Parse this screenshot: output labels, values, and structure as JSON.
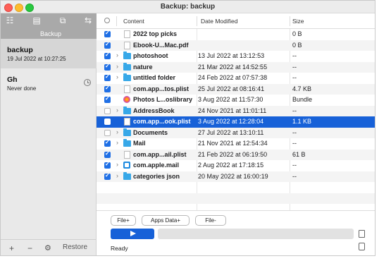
{
  "window": {
    "title": "Backup: backup"
  },
  "sidebar": {
    "section_label": "Backup",
    "items": [
      {
        "name": "backup",
        "subtitle": "19 Jul 2022 at 10:27:25",
        "selected": true
      },
      {
        "name": "Gh",
        "subtitle": "Never done",
        "selected": false
      }
    ],
    "bottom": {
      "add": "+",
      "remove": "−",
      "settings_icon": "gear-icon",
      "restore": "Restore"
    }
  },
  "table": {
    "headers": {
      "content": "Content",
      "date": "Date Modified",
      "size": "Size"
    },
    "rows": [
      {
        "checked": true,
        "expand": false,
        "icon": "file",
        "name": "2022 top picks",
        "date": "",
        "size": "0 B"
      },
      {
        "checked": true,
        "expand": false,
        "icon": "file",
        "name": "Ebook-U...Mac.pdf",
        "date": "",
        "size": "0 B"
      },
      {
        "checked": true,
        "expand": true,
        "icon": "folder",
        "name": "photoshoot",
        "date": "13 Jul 2022 at 13:12:53",
        "size": "--"
      },
      {
        "checked": true,
        "expand": true,
        "icon": "folder",
        "name": "nature",
        "date": "21 Mar 2022 at 14:52:55",
        "size": "--"
      },
      {
        "checked": true,
        "expand": true,
        "icon": "folder",
        "name": "untitled folder",
        "date": "24 Feb 2022 at 07:57:38",
        "size": "--"
      },
      {
        "checked": true,
        "expand": false,
        "icon": "file",
        "name": "com.app...tos.plist",
        "date": "25 Jul 2022 at 08:16:41",
        "size": "4.7 KB"
      },
      {
        "checked": true,
        "expand": false,
        "icon": "lib",
        "name": "Photos L...oslibrary",
        "date": "3 Aug 2022 at 11:57:30",
        "size": "Bundle"
      },
      {
        "checked": false,
        "expand": true,
        "icon": "folder",
        "name": "AddressBook",
        "date": "24 Nov 2021 at 11:01:11",
        "size": "--"
      },
      {
        "checked": false,
        "expand": false,
        "icon": "file",
        "name": "com.app...ook.plist",
        "date": "3 Aug 2022 at 12:28:04",
        "size": "1.1 KB",
        "selected": true
      },
      {
        "checked": false,
        "expand": true,
        "icon": "folder",
        "name": "Documents",
        "date": "27 Jul 2022 at 13:10:11",
        "size": "--"
      },
      {
        "checked": true,
        "expand": true,
        "icon": "folder",
        "name": "Mail",
        "date": "21 Nov 2021 at 12:54:34",
        "size": "--"
      },
      {
        "checked": true,
        "expand": false,
        "icon": "file",
        "name": "com.app...ail.plist",
        "date": "21 Feb 2022 at 06:19:50",
        "size": "61 B"
      },
      {
        "checked": true,
        "expand": true,
        "icon": "app",
        "name": "com.apple.mail",
        "date": "2 Aug 2022 at 17:18:15",
        "size": "--"
      },
      {
        "checked": true,
        "expand": true,
        "icon": "folder",
        "name": "categories json",
        "date": "20 May 2022 at 16:00:19",
        "size": "--"
      }
    ]
  },
  "buttons": {
    "file_add": "File+",
    "apps_data_add": "Apps Data+",
    "file_remove": "File-"
  },
  "status": {
    "text": "Ready",
    "progress": 0
  },
  "colors": {
    "accent": "#1761d8",
    "folder": "#37a8e8",
    "checkbox": "#1f6fe5"
  }
}
